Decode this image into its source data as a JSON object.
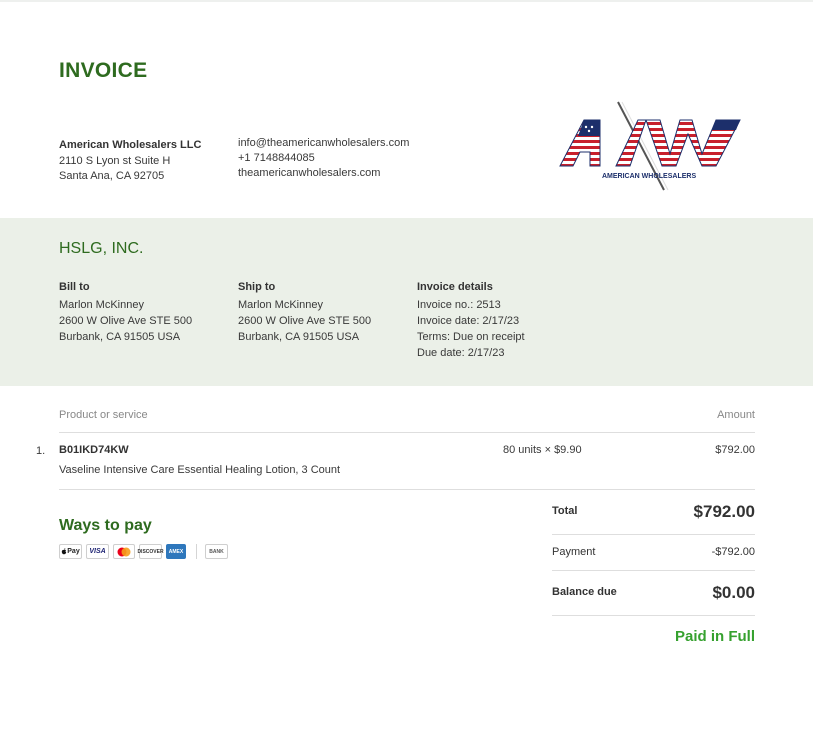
{
  "invoice_title": "INVOICE",
  "seller": {
    "name": "American Wholesalers LLC",
    "address_line1": "2110 S Lyon st Suite H",
    "address_line2": "Santa Ana, CA 92705",
    "email": "info@theamericanwholesalers.com",
    "phone": "+1 7148844085",
    "website": "theamericanwholesalers.com",
    "logo_initials": "AW",
    "logo_text": "AMERICAN WHOLESALERS"
  },
  "customer_name": "HSLG, INC.",
  "bill_to": {
    "heading": "Bill to",
    "name": "Marlon McKinney",
    "line1": "2600 W Olive Ave STE 500",
    "line2": "Burbank, CA 91505 USA"
  },
  "ship_to": {
    "heading": "Ship to",
    "name": "Marlon McKinney",
    "line1": "2600 W Olive Ave STE 500",
    "line2": "Burbank, CA 91505 USA"
  },
  "invoice_details": {
    "heading": "Invoice details",
    "number": "Invoice no.: 2513",
    "date": "Invoice date: 2/17/23",
    "terms": "Terms: Due on receipt",
    "due_date": "Due date: 2/17/23"
  },
  "table": {
    "col_product": "Product or service",
    "col_amount": "Amount",
    "items": [
      {
        "num": "1.",
        "sku": "B01IKD74KW",
        "description": "Vaseline Intensive Care Essential Healing Lotion, 3 Count",
        "qty_price": "80 units × $9.90",
        "amount": "$792.00"
      }
    ]
  },
  "payment_methods": {
    "heading": "Ways to pay",
    "icons": [
      {
        "name": "apple-pay-icon",
        "label": "Pay"
      },
      {
        "name": "visa-icon",
        "label": "VISA"
      },
      {
        "name": "mastercard-icon",
        "label": ""
      },
      {
        "name": "discover-icon",
        "label": "DISCOVER"
      },
      {
        "name": "amex-icon",
        "label": "AMEX"
      },
      {
        "name": "bank-icon",
        "label": "BANK"
      }
    ]
  },
  "summary": {
    "total_label": "Total",
    "total_value": "$792.00",
    "payment_label": "Payment",
    "payment_value": "-$792.00",
    "balance_label": "Balance due",
    "balance_value": "$0.00",
    "status": "Paid in Full"
  },
  "colors": {
    "brand_green": "#2e6b1f",
    "paid_green": "#36a12f",
    "band_bg": "#ebf0e8",
    "flag_red": "#c8202c",
    "flag_blue": "#1c2f6b"
  }
}
